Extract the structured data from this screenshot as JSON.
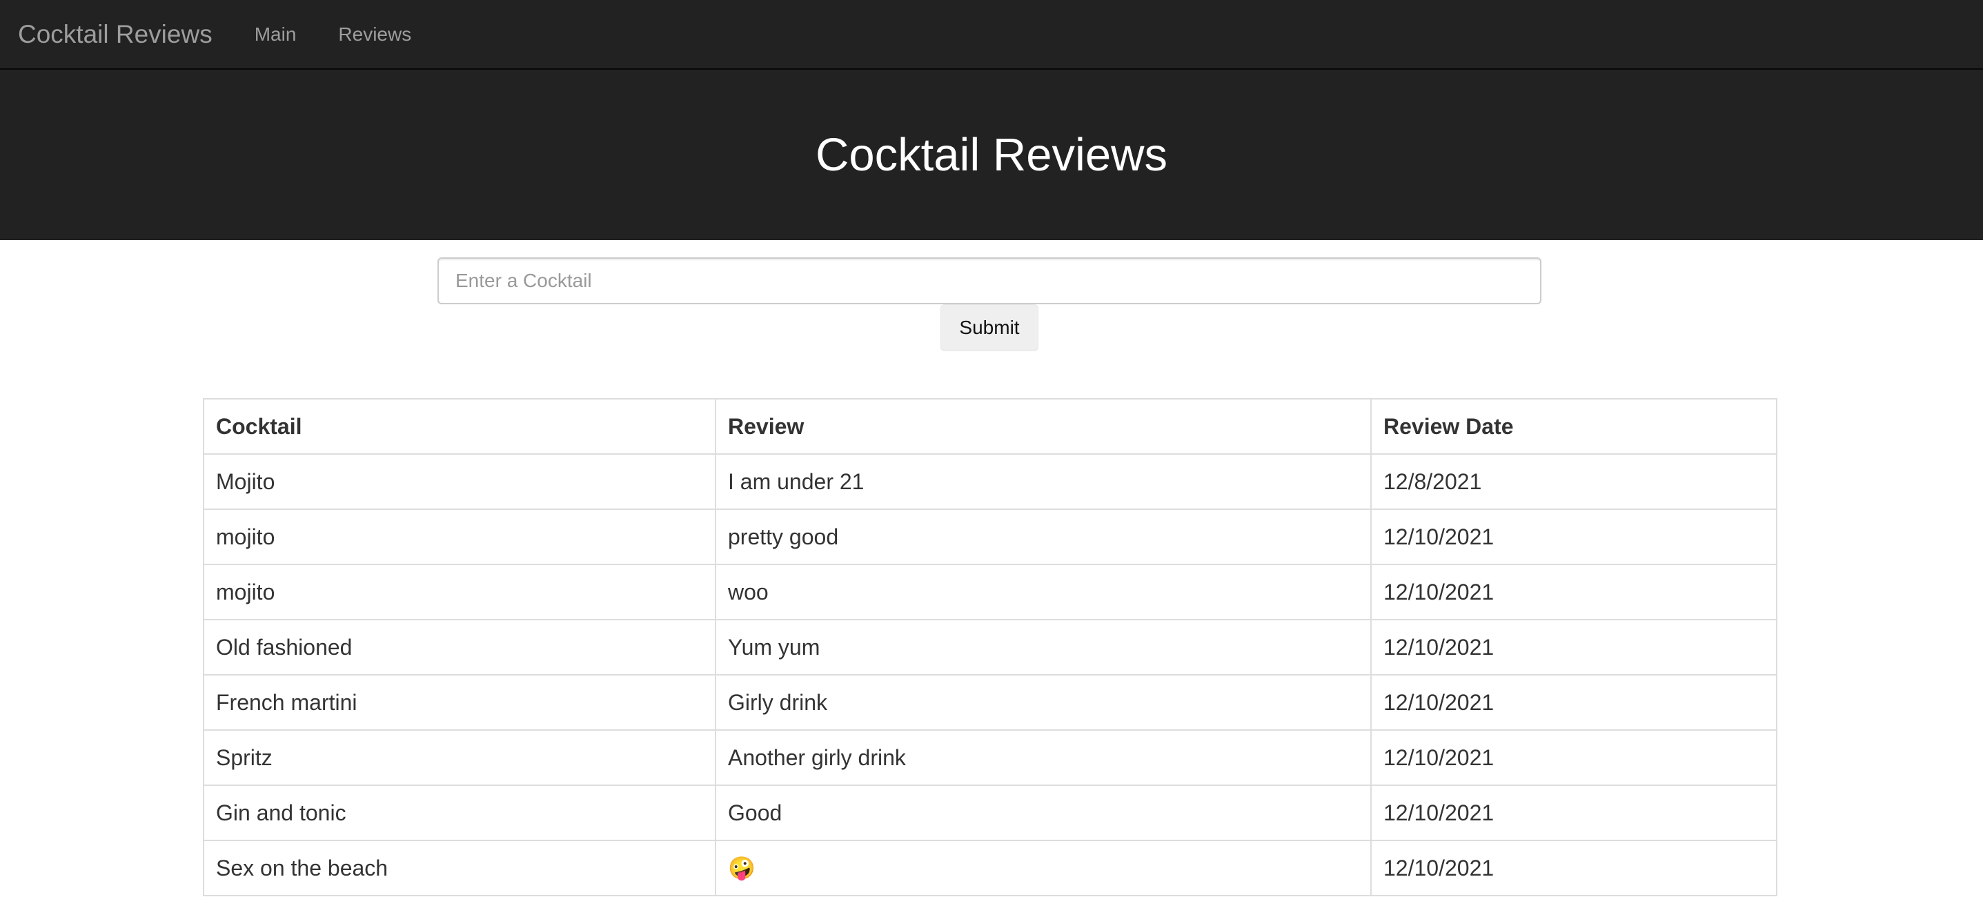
{
  "navbar": {
    "brand": "Cocktail Reviews",
    "links": [
      "Main",
      "Reviews"
    ]
  },
  "hero": {
    "title": "Cocktail Reviews"
  },
  "search": {
    "placeholder": "Enter a Cocktail",
    "value": "",
    "submit_label": "Submit"
  },
  "table": {
    "headers": [
      "Cocktail",
      "Review",
      "Review Date"
    ],
    "rows": [
      [
        "Mojito",
        "I am under 21",
        "12/8/2021"
      ],
      [
        "mojito",
        "pretty good",
        "12/10/2021"
      ],
      [
        "mojito",
        "woo",
        "12/10/2021"
      ],
      [
        "Old fashioned",
        "Yum yum",
        "12/10/2021"
      ],
      [
        "French martini",
        "Girly drink",
        "12/10/2021"
      ],
      [
        "Spritz",
        "Another girly drink",
        "12/10/2021"
      ],
      [
        "Gin and tonic",
        "Good",
        "12/10/2021"
      ],
      [
        "Sex on the beach",
        "🤪",
        "12/10/2021"
      ]
    ]
  },
  "colors": {
    "navbar_bg": "#222222",
    "nav_text": "#9d9d9d",
    "hero_text": "#ffffff",
    "border": "#dddddd"
  }
}
